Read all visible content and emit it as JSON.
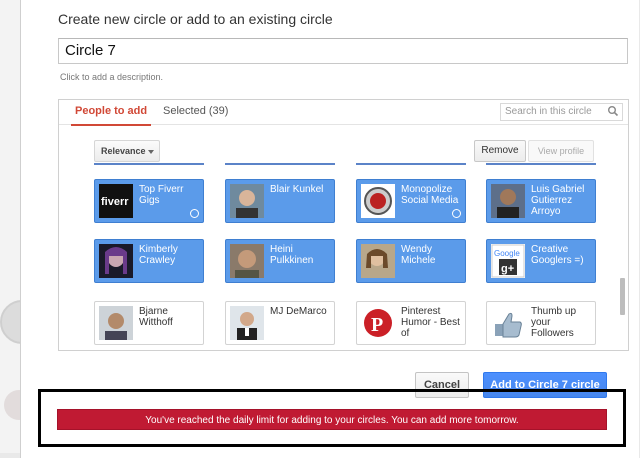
{
  "dialog": {
    "title": "Create new circle or add to an existing circle",
    "circle_name": "Circle 7",
    "description_hint": "Click to add a description."
  },
  "tabs": {
    "people_to_add": "People to add",
    "selected": "Selected (39)"
  },
  "search": {
    "placeholder": "Search in this circle"
  },
  "sort": {
    "selected": "Relevance"
  },
  "actions": {
    "remove": "Remove",
    "view_profile": "View profile"
  },
  "people": [
    {
      "name": "Top Fiverr Gigs",
      "selected": true,
      "pic": "fiverr-logo"
    },
    {
      "name": "Blair Kunkel",
      "selected": true,
      "pic": "avatar"
    },
    {
      "name": "Monopolize Social Media",
      "selected": true,
      "pic": "logo-badge"
    },
    {
      "name": "Luis Gabriel Gutierrez Arroyo",
      "selected": true,
      "pic": "avatar"
    },
    {
      "name": "Kimberly Crawley",
      "selected": true,
      "pic": "avatar"
    },
    {
      "name": "Heini Pulkkinen",
      "selected": true,
      "pic": "avatar"
    },
    {
      "name": "Wendy Michele",
      "selected": true,
      "pic": "avatar"
    },
    {
      "name": "Creative Googlers =)",
      "selected": true,
      "pic": "google-plus-logo"
    },
    {
      "name": "Bjarne Witthoff",
      "selected": false,
      "pic": "avatar"
    },
    {
      "name": "MJ DeMarco",
      "selected": false,
      "pic": "avatar"
    },
    {
      "name": "Pinterest Humor - Best of",
      "selected": false,
      "pic": "pinterest-logo"
    },
    {
      "name": "Thumb up your Followers",
      "selected": false,
      "pic": "thumbs-up"
    }
  ],
  "footer": {
    "cancel": "Cancel",
    "add": "Add to Circle 7 circle"
  },
  "alert": {
    "message": "You've reached the daily limit for adding to your circles. You can add more tomorrow."
  },
  "colors": {
    "card_blue": "#5b9bea",
    "accent_red": "#d14836",
    "alert_red": "#c01a33",
    "primary_blue": "#4d90fe"
  }
}
